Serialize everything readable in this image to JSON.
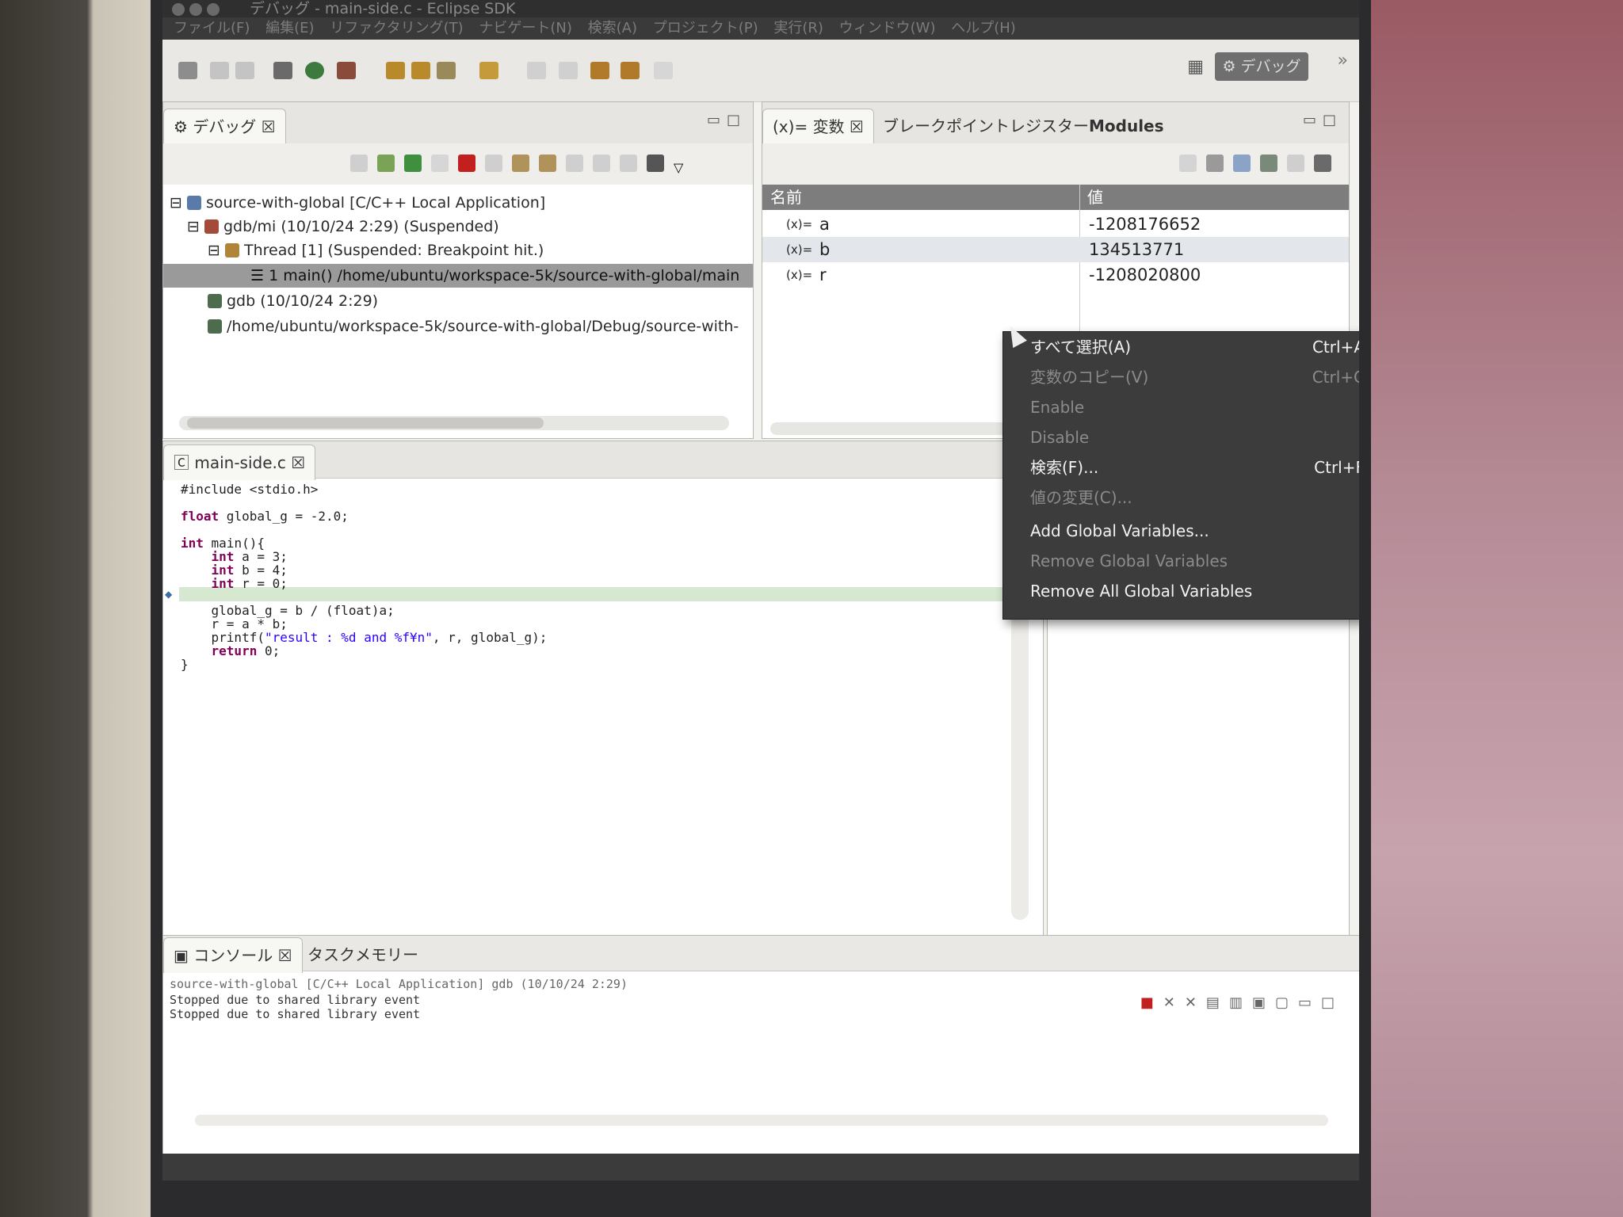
{
  "window": {
    "title": "デバッグ - main-side.c - Eclipse SDK",
    "menus": [
      "ファイル(F)",
      "編集(E)",
      "リファクタリング(T)",
      "ナビゲート(N)",
      "検索(A)",
      "プロジェクト(P)",
      "実行(R)",
      "ウィンドウ(W)",
      "ヘルプ(H)"
    ],
    "perspective": "デバッグ"
  },
  "debug_view": {
    "tab": "デバッグ",
    "tree": [
      "source-with-global [C/C++ Local Application]",
      "gdb/mi (10/10/24 2:29) (Suspended)",
      "Thread [1] (Suspended: Breakpoint hit.)",
      "1 main() /home/ubuntu/workspace-5k/source-with-global/main",
      "gdb (10/10/24 2:29)",
      "/home/ubuntu/workspace-5k/source-with-global/Debug/source-with-"
    ]
  },
  "variables_view": {
    "tabs": [
      "変数",
      "ブレークポイント",
      "レジスター",
      "Modules"
    ],
    "col_name": "名前",
    "col_value": "値",
    "rows": [
      {
        "name": "a",
        "value": "-1208176652"
      },
      {
        "name": "b",
        "value": "134513771"
      },
      {
        "name": "r",
        "value": "-1208020800"
      }
    ]
  },
  "editor": {
    "tab": "main-side.c",
    "lines": {
      "l1": "#include <stdio.h>",
      "l2a": "float",
      "l2b": " global_g = -2.0;",
      "l3a": "int",
      "l3b": " main(){",
      "l4a": "int",
      "l4b": " a = 3;",
      "l5a": "int",
      "l5b": " b = 4;",
      "l6a": "int",
      "l6b": " r = 0;",
      "l7": "global_g = b / (float)a;",
      "l8": "r = a * b;",
      "l9a": "printf(",
      "l9b": "\"result : %d and %f¥n\"",
      "l9c": ", r, global_g);",
      "l10a": "return",
      "l10b": " 0;",
      "l11": "}"
    }
  },
  "console": {
    "tabs": [
      "コンソール",
      "タスク",
      "メモリー"
    ],
    "header": "source-with-global [C/C++ Local Application] gdb (10/10/24 2:29)",
    "lines": [
      "Stopped due to shared library event",
      "Stopped due to shared library event"
    ]
  },
  "context_menu": {
    "items": [
      {
        "label": "すべて選択(A)",
        "accel": "Ctrl+A"
      },
      {
        "label": "変数のコピー(V)",
        "accel": "Ctrl+C"
      },
      {
        "label": "Enable",
        "accel": ""
      },
      {
        "label": "Disable",
        "accel": ""
      },
      {
        "label": "検索(F)...",
        "accel": "Ctrl+F"
      },
      {
        "label": "値の変更(C)...",
        "accel": ""
      },
      {
        "label": "Add Global Variables...",
        "accel": ""
      },
      {
        "label": "Remove Global Variables",
        "accel": ""
      },
      {
        "label": "Remove All Global Variables",
        "accel": ""
      }
    ]
  },
  "colors": {
    "menu_bg": "#3c3c3c",
    "selection": "#9a9a9a",
    "keyword": "#7f0055",
    "string": "#2a00ff"
  }
}
